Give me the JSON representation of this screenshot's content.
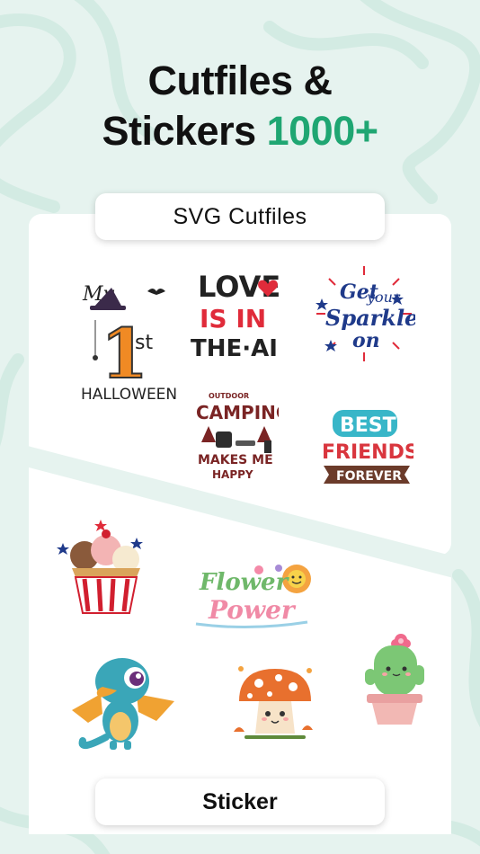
{
  "headline": {
    "line1": "Cutfiles &",
    "line2_text": "Stickers",
    "line2_accent": "1000+",
    "accent_color": "#1fa672"
  },
  "sections": {
    "svg_label": "SVG Cutfiles",
    "sticker_label": "Sticker"
  },
  "cutfiles": {
    "halloween": {
      "my": "My",
      "number": "1",
      "suffix": "st",
      "word": "HALLOWEEN"
    },
    "love": {
      "l1": "LOVE",
      "l2": "IS IN",
      "l3": "THE·AIR"
    },
    "sparkle": {
      "l1": "Get",
      "l2": "your",
      "l3": "Sparkle",
      "l4": "on"
    },
    "camping": {
      "l1": "OUTDOOR",
      "l2": "CAMPING",
      "l3": "MAKES ME",
      "l4": "HAPPY"
    },
    "friends": {
      "l1": "BEST",
      "l2": "FRIENDS",
      "l3": "FOREVER"
    }
  },
  "stickers": {
    "flower": {
      "l1": "Flower",
      "l2": "Power"
    }
  },
  "colors": {
    "background": "#e6f3ef",
    "card": "#ffffff",
    "text": "#111111"
  }
}
